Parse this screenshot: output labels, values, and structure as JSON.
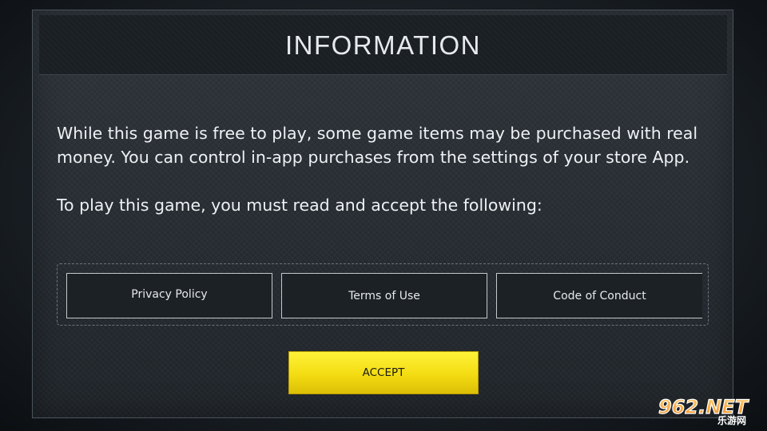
{
  "dialog": {
    "title": "INFORMATION",
    "paragraph_1": "While this game is free to play, some game items may be purchased with real money. You can control in-app purchases from the settings of your store App.",
    "paragraph_2": "To play this game, you must read and accept the following:"
  },
  "links": [
    {
      "label": "Privacy Policy"
    },
    {
      "label": "Terms of Use"
    },
    {
      "label": "Code of Conduct"
    }
  ],
  "accept_button": {
    "label": "ACCEPT",
    "color": "#f3dc12"
  },
  "watermark": {
    "text_main": "962.NET",
    "text_sub": "乐游网"
  },
  "colors": {
    "panel_bg": "#262c32",
    "header_bg": "#1a1f24",
    "text": "#eef1f3",
    "accent": "#f3dc12"
  }
}
